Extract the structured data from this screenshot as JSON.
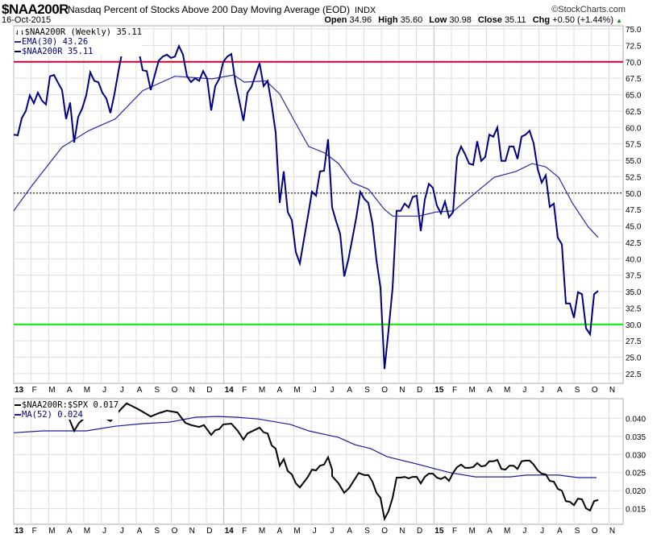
{
  "header": {
    "symbol": "$NAA200R",
    "description": "Nasdaq Percent of Stocks Above 200 Day Moving Average (EOD)",
    "exchange": "INDX",
    "copyright": "©StockCharts.com",
    "date": "16-Oct-2015",
    "open_label": "Open",
    "open": "34.96",
    "high_label": "High",
    "high": "35.60",
    "low_label": "Low",
    "low": "30.98",
    "close_label": "Close",
    "close": "35.11",
    "chg_label": "Chg",
    "chg": "+0.50 (+1.44%)"
  },
  "colors": {
    "price": "#000080",
    "ema": "#2a2aa8",
    "ratio": "#000000",
    "ma": "#1a1aa0",
    "overbought": "#cc0033",
    "oversold": "#00ee00",
    "grid": "#dddddd"
  },
  "chart_data": [
    {
      "type": "line",
      "title": "$NAA200R (Weekly) 35.11",
      "legend": [
        "EMA(30) 43.26",
        "$NAA200R 35.11"
      ],
      "x_start": "2013-01-04",
      "x_interval": "weekly",
      "ylim": [
        21.5,
        75.5
      ],
      "yticks": [
        "75.0",
        "72.5",
        "70.0",
        "67.5",
        "65.0",
        "62.5",
        "60.0",
        "57.5",
        "55.0",
        "52.5",
        "50.0",
        "47.5",
        "45.0",
        "42.5",
        "40.0",
        "37.5",
        "35.0",
        "32.5",
        "30.0",
        "27.5",
        "25.0",
        "22.5"
      ],
      "reference_lines": [
        {
          "value": 70,
          "color": "#cc0033"
        },
        {
          "value": 50,
          "style": "dotted"
        },
        {
          "value": 30,
          "color": "#00ee00"
        }
      ],
      "series": [
        {
          "name": "$NAA200R",
          "values": [
            58.9,
            58.8,
            61.4,
            62.5,
            64.9,
            63.7,
            65.3,
            64.1,
            63.5,
            67.8,
            68.0,
            66.8,
            65.7,
            61.3,
            63.8,
            57.7,
            61.6,
            62.9,
            64.9,
            68.4,
            67.1,
            66.9,
            65.3,
            64.4,
            62.2,
            65.1,
            68.6,
            71.8,
            74.1,
            73.9,
            73.9,
            71.8,
            68.7,
            68.6,
            65.7,
            68.0,
            70.2,
            70.8,
            71.1,
            70.6,
            70.8,
            72.4,
            71.1,
            67.8,
            66.9,
            67.5,
            67.1,
            68.6,
            67.4,
            62.6,
            66.3,
            67.4,
            70.0,
            70.8,
            71.2,
            66.9,
            64.0,
            61.0,
            65.3,
            66.2,
            68.0,
            69.8,
            66.3,
            67.1,
            63.5,
            59.2,
            48.5,
            53.3,
            47.1,
            45.9,
            41.0,
            39.3,
            42.9,
            46.5,
            50.2,
            49.6,
            53.3,
            53.4,
            58.2,
            47.8,
            45.7,
            43.8,
            37.3,
            39.8,
            43.0,
            46.3,
            50.2,
            49.1,
            48.5,
            45.4,
            39.8,
            35.6,
            23.2,
            29.1,
            35.5,
            47.3,
            47.3,
            48.4,
            47.8,
            49.4,
            49.6,
            44.2,
            49.0,
            51.4,
            50.8,
            48.1,
            46.9,
            48.7,
            46.3,
            47.1,
            55.5,
            57.1,
            55.9,
            54.5,
            54.3,
            57.9,
            54.9,
            55.5,
            58.9,
            58.6,
            60.0,
            54.9,
            54.9,
            57.1,
            57.1,
            55.2,
            58.6,
            58.9,
            59.5,
            57.6,
            53.7,
            51.6,
            52.7,
            47.9,
            48.4,
            43.2,
            42.2,
            33.2,
            33.2,
            31.0,
            34.9,
            34.6,
            29.4,
            28.5,
            34.6,
            35.11
          ]
        },
        {
          "name": "EMA(30)",
          "points": [
            [
              0,
              47.3
            ],
            [
              4.6,
              51.2
            ],
            [
              12,
              57.0
            ],
            [
              18.6,
              59.5
            ],
            [
              25.2,
              61.3
            ],
            [
              32,
              65.6
            ],
            [
              40,
              67.8
            ],
            [
              49.2,
              67.4
            ],
            [
              54.6,
              68.0
            ],
            [
              57.2,
              66.9
            ],
            [
              62.6,
              67.1
            ],
            [
              66,
              65.1
            ],
            [
              70,
              60.6
            ],
            [
              73.2,
              57.1
            ],
            [
              77.2,
              56.1
            ],
            [
              80.6,
              54.5
            ],
            [
              84,
              51.6
            ],
            [
              88,
              50.6
            ],
            [
              92,
              47.5
            ],
            [
              94,
              46.5
            ],
            [
              100.6,
              46.5
            ],
            [
              104.6,
              47.1
            ],
            [
              109.2,
              47.3
            ],
            [
              119.2,
              52.4
            ],
            [
              124.6,
              53.3
            ],
            [
              128.6,
              54.5
            ],
            [
              132,
              54.0
            ],
            [
              135.2,
              52.4
            ],
            [
              138.6,
              48.5
            ],
            [
              142.6,
              44.8
            ],
            [
              145,
              43.26
            ]
          ]
        }
      ]
    },
    {
      "type": "line",
      "legend": [
        "$NAA200R:$SPX 0.017",
        "MA(52) 0.024"
      ],
      "ylim": [
        0.0107,
        0.0454
      ],
      "yticks": [
        "0.040",
        "0.035",
        "0.030",
        "0.025",
        "0.020",
        "0.015"
      ],
      "series": [
        {
          "name": "$NAA200R:$SPX",
          "segments": [
            [
              [
                0,
                0.0403
              ],
              [
                1,
                0.0398
              ]
            ],
            [
              [
                12.6,
                0.0403
              ],
              [
                13.6,
                0.0403
              ],
              [
                15,
                0.0365
              ],
              [
                16.2,
                0.0387
              ],
              [
                18,
                0.0405
              ],
              [
                20,
                0.041
              ],
              [
                22,
                0.0405
              ],
              [
                24,
                0.0392
              ],
              [
                26.6,
                0.0425
              ],
              [
                28,
                0.0441
              ],
              [
                30.6,
                0.0427
              ],
              [
                32.6,
                0.0414
              ],
              [
                34,
                0.0405
              ],
              [
                36,
                0.0414
              ],
              [
                38,
                0.0421
              ],
              [
                40.6,
                0.0416
              ],
              [
                42.6,
                0.0387
              ],
              [
                44,
                0.0381
              ],
              [
                46,
                0.0376
              ],
              [
                47.2,
                0.0381
              ],
              [
                49,
                0.0354
              ],
              [
                50,
                0.0367
              ],
              [
                51,
                0.037
              ],
              [
                52,
                0.0383
              ],
              [
                54,
                0.0385
              ],
              [
                55.6,
                0.0365
              ],
              [
                57,
                0.0341
              ],
              [
                58,
                0.0358
              ],
              [
                61,
                0.0374
              ],
              [
                62,
                0.0361
              ],
              [
                63,
                0.0358
              ],
              [
                64,
                0.0325
              ],
              [
                65,
                0.0316
              ],
              [
                66,
                0.0269
              ],
              [
                67,
                0.0287
              ],
              [
                68,
                0.0254
              ],
              [
                69,
                0.0245
              ],
              [
                70,
                0.022
              ],
              [
                71,
                0.0209
              ],
              [
                73,
                0.0238
              ],
              [
                74,
                0.0258
              ],
              [
                75,
                0.0256
              ],
              [
                76,
                0.0269
              ],
              [
                77,
                0.0272
              ],
              [
                78,
                0.0292
              ],
              [
                79,
                0.0258
              ],
              [
                79,
                0.024
              ],
              [
                80.6,
                0.022
              ],
              [
                82,
                0.0194
              ],
              [
                83.2,
                0.0207
              ],
              [
                85.6,
                0.0249
              ],
              [
                87,
                0.0243
              ],
              [
                88,
                0.0243
              ],
              [
                89,
                0.0225
              ],
              [
                90,
                0.0194
              ],
              [
                91,
                0.018
              ],
              [
                92,
                0.0122
              ],
              [
                93,
                0.0143
              ],
              [
                94,
                0.018
              ],
              [
                95,
                0.0236
              ],
              [
                96,
                0.0236
              ],
              [
                97,
                0.0238
              ],
              [
                98,
                0.0234
              ],
              [
                99,
                0.0238
              ],
              [
                100,
                0.0238
              ],
              [
                101,
                0.022
              ],
              [
                102,
                0.0238
              ],
              [
                103,
                0.0247
              ],
              [
                104,
                0.0247
              ],
              [
                105,
                0.0236
              ],
              [
                106,
                0.0232
              ],
              [
                107,
                0.0238
              ],
              [
                108,
                0.0227
              ],
              [
                109,
                0.0249
              ],
              [
                110,
                0.0265
              ],
              [
                111,
                0.0272
              ],
              [
                112,
                0.0263
              ],
              [
                113,
                0.0263
              ],
              [
                114,
                0.0265
              ],
              [
                115,
                0.0276
              ],
              [
                116,
                0.0267
              ],
              [
                117,
                0.0269
              ],
              [
                118,
                0.0281
              ],
              [
                119,
                0.0281
              ],
              [
                120,
                0.0285
              ],
              [
                121,
                0.026
              ],
              [
                122,
                0.0258
              ],
              [
                123,
                0.0269
              ],
              [
                124,
                0.0269
              ],
              [
                125,
                0.026
              ],
              [
                126,
                0.0281
              ],
              [
                127,
                0.0283
              ],
              [
                128,
                0.0283
              ],
              [
                129,
                0.0272
              ],
              [
                130,
                0.0256
              ],
              [
                131,
                0.0247
              ],
              [
                132,
                0.0245
              ],
              [
                133,
                0.0227
              ],
              [
                134,
                0.0225
              ],
              [
                135,
                0.0205
              ],
              [
                136,
                0.02
              ],
              [
                137,
                0.0171
              ],
              [
                138,
                0.0169
              ],
              [
                139,
                0.016
              ],
              [
                140,
                0.0178
              ],
              [
                141,
                0.0176
              ],
              [
                142,
                0.0151
              ],
              [
                143,
                0.0145
              ],
              [
                144,
                0.0171
              ],
              [
                145,
                0.0174
              ]
            ]
          ]
        },
        {
          "name": "MA(52)",
          "points": [
            [
              0,
              0.036
            ],
            [
              7.2,
              0.0365
            ],
            [
              15,
              0.0365
            ],
            [
              18,
              0.0365
            ],
            [
              25.2,
              0.0378
            ],
            [
              32,
              0.0385
            ],
            [
              38.6,
              0.0389
            ],
            [
              45.2,
              0.0403
            ],
            [
              50.6,
              0.0405
            ],
            [
              55.2,
              0.0403
            ],
            [
              60.6,
              0.0398
            ],
            [
              68.6,
              0.0383
            ],
            [
              73.2,
              0.0365
            ],
            [
              78.6,
              0.0352
            ],
            [
              80.6,
              0.0347
            ],
            [
              84.6,
              0.0327
            ],
            [
              88.6,
              0.0316
            ],
            [
              92.6,
              0.0294
            ],
            [
              96.6,
              0.0283
            ],
            [
              100.6,
              0.0272
            ],
            [
              104.6,
              0.026
            ],
            [
              108.6,
              0.0249
            ],
            [
              114.6,
              0.0238
            ],
            [
              123.2,
              0.0238
            ],
            [
              127.2,
              0.0243
            ],
            [
              135.2,
              0.0243
            ],
            [
              140,
              0.0236
            ],
            [
              144.6,
              0.0236
            ]
          ]
        }
      ]
    }
  ],
  "x_axis": {
    "labels": [
      "13",
      "F",
      "M",
      "A",
      "M",
      "J",
      "J",
      "A",
      "S",
      "O",
      "N",
      "D",
      "14",
      "F",
      "M",
      "A",
      "M",
      "J",
      "J",
      "A",
      "S",
      "O",
      "N",
      "D",
      "15",
      "F",
      "M",
      "A",
      "M",
      "J",
      "J",
      "A",
      "S",
      "O",
      "N"
    ]
  }
}
